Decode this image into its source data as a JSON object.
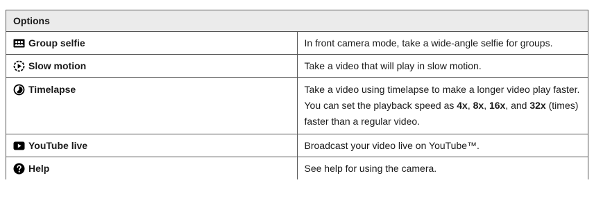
{
  "header": {
    "title": "Options"
  },
  "rows": [
    {
      "name": "Group selfie",
      "icon": "group-selfie-icon",
      "desc": "In front camera mode, take a wide-angle selfie for groups."
    },
    {
      "name": "Slow motion",
      "icon": "slow-motion-icon",
      "desc": "Take a video that will play in slow motion."
    },
    {
      "name": "Timelapse",
      "icon": "timelapse-icon",
      "desc_a": "Take a video using timelapse to make a longer video play faster. You can set the playback speed as ",
      "speed1": "4x",
      "sep1": ", ",
      "speed2": "8x",
      "sep2": ", ",
      "speed3": "16x",
      "sep3": ", and ",
      "speed4": "32x",
      "desc_b": " (times) faster than a regular video."
    },
    {
      "name": "YouTube live",
      "icon": "youtube-icon",
      "desc": "Broadcast your video live on YouTube™."
    },
    {
      "name": "Help",
      "icon": "help-icon",
      "desc": "See help for using the camera."
    }
  ]
}
